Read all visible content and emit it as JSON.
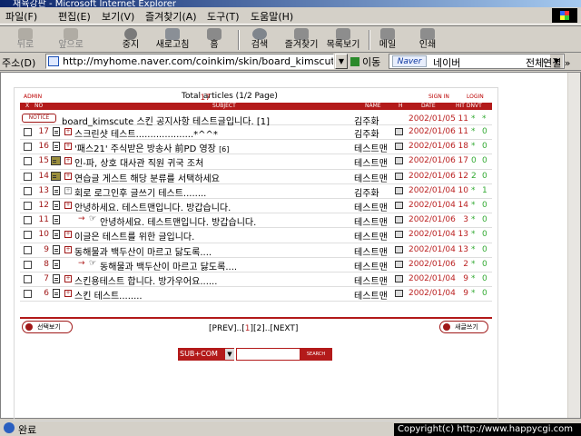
{
  "window": {
    "title": "재육강판 - Microsoft Internet Explorer"
  },
  "menu": [
    "파일(F)",
    "편집(E)",
    "보기(V)",
    "즐겨찾기(A)",
    "도구(T)",
    "도움말(H)"
  ],
  "toolbar": {
    "back": "뒤로",
    "forward": "앞으로",
    "stop": "중지",
    "refresh": "새로고침",
    "home": "홈",
    "search": "검색",
    "favorites": "즐겨찾기",
    "history": "목록보기",
    "mail": "메일",
    "print": "인쇄"
  },
  "address": {
    "label": "주소(D)",
    "url": "http://myhome.naver.com/coinkim/skin/board_kimscute_red",
    "go": "이동",
    "naver_logo": "Naver",
    "naver_query": "네이버",
    "naver_all": "전체:",
    "links": "연결 »"
  },
  "board": {
    "admin": "ADMIN",
    "total_prefix": "Total",
    "total_count": "17",
    "total_suffix": "articles (1/2 Page)",
    "signin": "SIGN IN",
    "login": "LOGIN",
    "header": {
      "x": "X",
      "no": "NO",
      "subject": "SUBJECT",
      "name": "NAME",
      "h": "H",
      "date": "DATE",
      "hit": "HIT DNVT"
    },
    "notice": {
      "badge": "NOTICE",
      "title": "board_kimscute 스킨 공지사항 테스트글입니다.",
      "comments": "[1]",
      "name": "김주화",
      "date": "2002/01/05",
      "hit": "11",
      "star": "*",
      "vote": "*"
    },
    "rows": [
      {
        "no": "17",
        "title": "스크린샷 테스트....................*^^*",
        "comments": "",
        "name": "김주화",
        "date": "2002/01/06",
        "hit": "11",
        "star": "*",
        "vote": "0"
      },
      {
        "no": "16",
        "title": "'패스21' 주식받은 방송사 前PD 영장",
        "comments": "[6]",
        "name": "테스트맨",
        "date": "2002/01/06",
        "hit": "18",
        "star": "*",
        "vote": "0"
      },
      {
        "no": "15",
        "title": "인-파, 상호 대사관 직원 귀국 조처",
        "comments": "",
        "name": "테스트맨",
        "date": "2002/01/06",
        "hit": "17",
        "star": "0",
        "vote": "0"
      },
      {
        "no": "14",
        "title": "연습글 게스트 해당 분류를 서택하세요",
        "comments": "",
        "name": "테스트맨",
        "date": "2002/01/06",
        "hit": "12",
        "star": "2",
        "vote": "0"
      },
      {
        "no": "13",
        "title": "회로 로그인후 글쓰기 테스트........",
        "comments": "",
        "name": "김주화",
        "date": "2002/01/04",
        "hit": "10",
        "star": "*",
        "vote": "1"
      },
      {
        "no": "12",
        "title": "안녕하세요. 테스트맨입니다. 방갑습니다.",
        "comments": "",
        "name": "테스트맨",
        "date": "2002/01/04",
        "hit": "14",
        "star": "*",
        "vote": "0"
      },
      {
        "no": "11",
        "title": "안녕하세요. 테스트맨입니다. 방갑습니다.",
        "comments": "",
        "name": "테스트맨",
        "date": "2002/01/06",
        "hit": "3",
        "star": "*",
        "vote": "0"
      },
      {
        "no": "10",
        "title": "이글은 테스트를 위한 글입니다.",
        "comments": "",
        "name": "테스트맨",
        "date": "2002/01/04",
        "hit": "13",
        "star": "*",
        "vote": "0"
      },
      {
        "no": "9",
        "title": "동해물과 백두산이 마르고 닳도록....",
        "comments": "",
        "name": "테스트맨",
        "date": "2002/01/04",
        "hit": "13",
        "star": "*",
        "vote": "0"
      },
      {
        "no": "8",
        "title": "동해물과 백두산이 마르고 닳도록....",
        "comments": "",
        "name": "테스트맨",
        "date": "2002/01/06",
        "hit": "2",
        "star": "*",
        "vote": "0"
      },
      {
        "no": "7",
        "title": "스킨용테스트 합니다. 방가우어요......",
        "comments": "",
        "name": "테스트맨",
        "date": "2002/01/04",
        "hit": "9",
        "star": "*",
        "vote": "0"
      },
      {
        "no": "6",
        "title": "스킨 테스트........",
        "comments": "",
        "name": "테스트맨",
        "date": "2002/01/04",
        "hit": "9",
        "star": "*",
        "vote": "0"
      }
    ],
    "select_btn": "선택보기",
    "write_btn": "새글쓰기",
    "pager": {
      "prev": "[PREV]..[",
      "p1": "1",
      "mid": "][2]..[NEXT]"
    },
    "search_field": "SUB+COM",
    "search_btn": "SEARCH"
  },
  "status": {
    "text": "완료",
    "copyright": "Copyright(c) http://www.happycgi.com"
  }
}
